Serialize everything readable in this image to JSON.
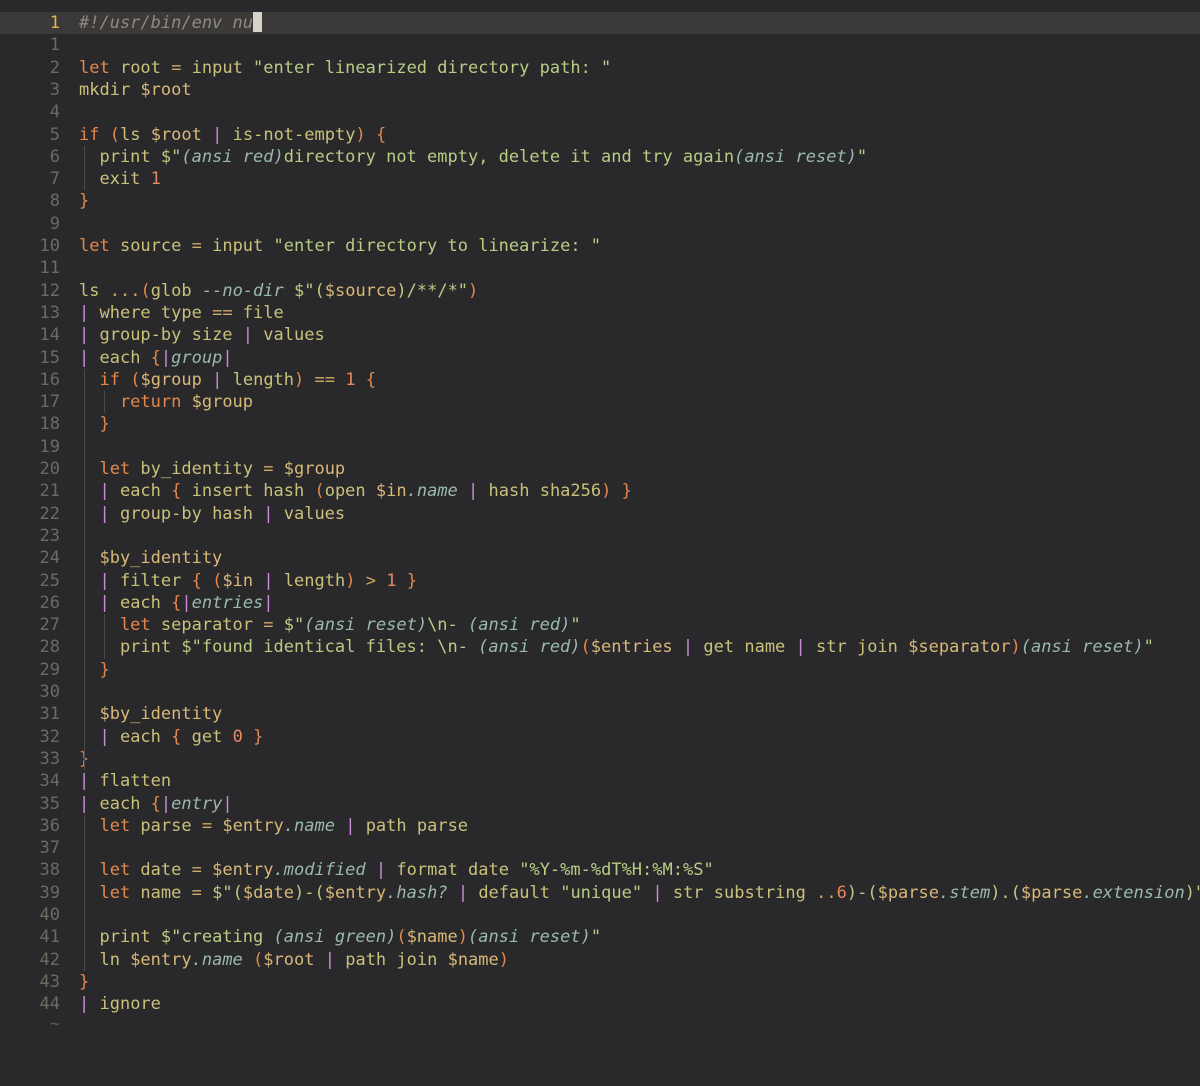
{
  "editor": {
    "tilde": "~",
    "lines": [
      {
        "num": "1",
        "tokens": [
          [
            "com",
            "#!/usr/bin/env nu"
          ]
        ],
        "cursor": true
      },
      {
        "num": "1",
        "tokens": []
      },
      {
        "num": "2",
        "tokens": [
          [
            "kw",
            "let"
          ],
          [
            "fn",
            " root "
          ],
          [
            "op",
            "="
          ],
          [
            "fn",
            " input "
          ],
          [
            "str",
            "\"enter linearized directory path: \""
          ]
        ]
      },
      {
        "num": "3",
        "tokens": [
          [
            "fn",
            "mkdir "
          ],
          [
            "var",
            "$root"
          ]
        ]
      },
      {
        "num": "4",
        "tokens": []
      },
      {
        "num": "5",
        "tokens": [
          [
            "kw",
            "if"
          ],
          [
            "fn",
            " "
          ],
          [
            "br",
            "("
          ],
          [
            "fn",
            "ls "
          ],
          [
            "var",
            "$root"
          ],
          [
            "fn",
            " "
          ],
          [
            "pipe",
            "|"
          ],
          [
            "fn",
            " is-not-empty"
          ],
          [
            "br",
            ")"
          ],
          [
            "fn",
            " "
          ],
          [
            "br",
            "{"
          ]
        ]
      },
      {
        "num": "6",
        "tokens": [
          [
            "fn",
            "  print "
          ],
          [
            "str",
            "$\""
          ],
          [
            "it",
            "(ansi red)"
          ],
          [
            "str",
            "directory not empty, delete it and try again"
          ],
          [
            "it",
            "(ansi reset)"
          ],
          [
            "str",
            "\""
          ]
        ]
      },
      {
        "num": "7",
        "tokens": [
          [
            "fn",
            "  exit "
          ],
          [
            "num",
            "1"
          ]
        ]
      },
      {
        "num": "8",
        "tokens": [
          [
            "br",
            "}"
          ]
        ]
      },
      {
        "num": "9",
        "tokens": []
      },
      {
        "num": "10",
        "tokens": [
          [
            "kw",
            "let"
          ],
          [
            "fn",
            " source "
          ],
          [
            "op",
            "="
          ],
          [
            "fn",
            " input "
          ],
          [
            "str",
            "\"enter directory to linearize: \""
          ]
        ]
      },
      {
        "num": "11",
        "tokens": []
      },
      {
        "num": "12",
        "tokens": [
          [
            "fn",
            "ls "
          ],
          [
            "op",
            "..."
          ],
          [
            "br",
            "("
          ],
          [
            "fn",
            "glob "
          ],
          [
            "it",
            "--no-dir"
          ],
          [
            "fn",
            " "
          ],
          [
            "str",
            "$\"("
          ],
          [
            "var",
            "$source"
          ],
          [
            "str",
            ")/**/*\""
          ],
          [
            "br",
            ")"
          ]
        ]
      },
      {
        "num": "13",
        "tokens": [
          [
            "pipe",
            "|"
          ],
          [
            "fn",
            " where type "
          ],
          [
            "op",
            "=="
          ],
          [
            "fn",
            " file"
          ]
        ]
      },
      {
        "num": "14",
        "tokens": [
          [
            "pipe",
            "|"
          ],
          [
            "fn",
            " group-by size "
          ],
          [
            "pipe",
            "|"
          ],
          [
            "fn",
            " values"
          ]
        ]
      },
      {
        "num": "15",
        "tokens": [
          [
            "pipe",
            "|"
          ],
          [
            "fn",
            " each "
          ],
          [
            "br",
            "{"
          ],
          [
            "pipe",
            "|"
          ],
          [
            "it",
            "group"
          ],
          [
            "pipe",
            "|"
          ]
        ]
      },
      {
        "num": "16",
        "tokens": [
          [
            "kw",
            "  if"
          ],
          [
            "fn",
            " "
          ],
          [
            "br",
            "("
          ],
          [
            "var",
            "$group"
          ],
          [
            "fn",
            " "
          ],
          [
            "pipe",
            "|"
          ],
          [
            "fn",
            " length"
          ],
          [
            "br",
            ")"
          ],
          [
            "fn",
            " "
          ],
          [
            "op",
            "=="
          ],
          [
            "fn",
            " "
          ],
          [
            "num",
            "1"
          ],
          [
            "fn",
            " "
          ],
          [
            "br",
            "{"
          ]
        ]
      },
      {
        "num": "17",
        "tokens": [
          [
            "kw",
            "    return"
          ],
          [
            "fn",
            " "
          ],
          [
            "var",
            "$group"
          ]
        ]
      },
      {
        "num": "18",
        "tokens": [
          [
            "br",
            "  }"
          ]
        ]
      },
      {
        "num": "19",
        "tokens": []
      },
      {
        "num": "20",
        "tokens": [
          [
            "kw",
            "  let"
          ],
          [
            "fn",
            " by_identity "
          ],
          [
            "op",
            "="
          ],
          [
            "fn",
            " "
          ],
          [
            "var",
            "$group"
          ]
        ]
      },
      {
        "num": "21",
        "tokens": [
          [
            "pipe",
            "  |"
          ],
          [
            "fn",
            " each "
          ],
          [
            "br",
            "{"
          ],
          [
            "fn",
            " insert hash "
          ],
          [
            "br",
            "("
          ],
          [
            "fn",
            "open "
          ],
          [
            "var",
            "$in"
          ],
          [
            "it",
            ".name"
          ],
          [
            "fn",
            " "
          ],
          [
            "pipe",
            "|"
          ],
          [
            "fn",
            " hash sha256"
          ],
          [
            "br",
            ")"
          ],
          [
            "fn",
            " "
          ],
          [
            "br",
            "}"
          ]
        ]
      },
      {
        "num": "22",
        "tokens": [
          [
            "pipe",
            "  |"
          ],
          [
            "fn",
            " group-by hash "
          ],
          [
            "pipe",
            "|"
          ],
          [
            "fn",
            " values"
          ]
        ]
      },
      {
        "num": "23",
        "tokens": []
      },
      {
        "num": "24",
        "tokens": [
          [
            "var",
            "  $by_identity"
          ]
        ]
      },
      {
        "num": "25",
        "tokens": [
          [
            "pipe",
            "  |"
          ],
          [
            "fn",
            " filter "
          ],
          [
            "br",
            "{"
          ],
          [
            "fn",
            " "
          ],
          [
            "br",
            "("
          ],
          [
            "var",
            "$in"
          ],
          [
            "fn",
            " "
          ],
          [
            "pipe",
            "|"
          ],
          [
            "fn",
            " length"
          ],
          [
            "br",
            ")"
          ],
          [
            "fn",
            " "
          ],
          [
            "op",
            ">"
          ],
          [
            "fn",
            " "
          ],
          [
            "num",
            "1"
          ],
          [
            "fn",
            " "
          ],
          [
            "br",
            "}"
          ]
        ]
      },
      {
        "num": "26",
        "tokens": [
          [
            "pipe",
            "  |"
          ],
          [
            "fn",
            " each "
          ],
          [
            "br",
            "{"
          ],
          [
            "pipe",
            "|"
          ],
          [
            "it",
            "entries"
          ],
          [
            "pipe",
            "|"
          ]
        ]
      },
      {
        "num": "27",
        "tokens": [
          [
            "kw",
            "    let"
          ],
          [
            "fn",
            " separator "
          ],
          [
            "op",
            "="
          ],
          [
            "fn",
            " "
          ],
          [
            "str",
            "$\""
          ],
          [
            "it",
            "(ansi reset)"
          ],
          [
            "str",
            "\\n- "
          ],
          [
            "it",
            "(ansi red)"
          ],
          [
            "str",
            "\""
          ]
        ]
      },
      {
        "num": "28",
        "tokens": [
          [
            "fn",
            "    print "
          ],
          [
            "str",
            "$\"found identical files: \\n- "
          ],
          [
            "it",
            "(ansi red)"
          ],
          [
            "br",
            "("
          ],
          [
            "var",
            "$entries"
          ],
          [
            "fn",
            " "
          ],
          [
            "pipe",
            "|"
          ],
          [
            "fn",
            " get name "
          ],
          [
            "pipe",
            "|"
          ],
          [
            "fn",
            " str join "
          ],
          [
            "var",
            "$separator"
          ],
          [
            "br",
            ")"
          ],
          [
            "it",
            "(ansi reset)"
          ],
          [
            "str",
            "\""
          ]
        ]
      },
      {
        "num": "29",
        "tokens": [
          [
            "br",
            "  }"
          ]
        ]
      },
      {
        "num": "30",
        "tokens": []
      },
      {
        "num": "31",
        "tokens": [
          [
            "var",
            "  $by_identity"
          ]
        ]
      },
      {
        "num": "32",
        "tokens": [
          [
            "pipe",
            "  |"
          ],
          [
            "fn",
            " each "
          ],
          [
            "br",
            "{"
          ],
          [
            "fn",
            " get "
          ],
          [
            "num",
            "0"
          ],
          [
            "fn",
            " "
          ],
          [
            "br",
            "}"
          ]
        ]
      },
      {
        "num": "33",
        "tokens": [
          [
            "br",
            "}"
          ]
        ]
      },
      {
        "num": "34",
        "tokens": [
          [
            "pipe",
            "|"
          ],
          [
            "fn",
            " flatten"
          ]
        ]
      },
      {
        "num": "35",
        "tokens": [
          [
            "pipe",
            "|"
          ],
          [
            "fn",
            " each "
          ],
          [
            "br",
            "{"
          ],
          [
            "pipe",
            "|"
          ],
          [
            "it",
            "entry"
          ],
          [
            "pipe",
            "|"
          ]
        ]
      },
      {
        "num": "36",
        "tokens": [
          [
            "kw",
            "  let"
          ],
          [
            "fn",
            " parse "
          ],
          [
            "op",
            "="
          ],
          [
            "fn",
            " "
          ],
          [
            "var",
            "$entry"
          ],
          [
            "it",
            ".name"
          ],
          [
            "fn",
            " "
          ],
          [
            "pipe",
            "|"
          ],
          [
            "fn",
            " path parse"
          ]
        ]
      },
      {
        "num": "37",
        "tokens": []
      },
      {
        "num": "38",
        "tokens": [
          [
            "kw",
            "  let"
          ],
          [
            "fn",
            " date "
          ],
          [
            "op",
            "="
          ],
          [
            "fn",
            " "
          ],
          [
            "var",
            "$entry"
          ],
          [
            "it",
            ".modified"
          ],
          [
            "fn",
            " "
          ],
          [
            "pipe",
            "|"
          ],
          [
            "fn",
            " format date "
          ],
          [
            "str",
            "\"%Y-%m-%dT%H:%M:%S\""
          ]
        ]
      },
      {
        "num": "39",
        "tokens": [
          [
            "kw",
            "  let"
          ],
          [
            "fn",
            " name "
          ],
          [
            "op",
            "="
          ],
          [
            "fn",
            " "
          ],
          [
            "str",
            "$\"("
          ],
          [
            "var",
            "$date"
          ],
          [
            "str",
            ")-("
          ],
          [
            "var",
            "$entry"
          ],
          [
            "it",
            ".hash?"
          ],
          [
            "fn",
            " "
          ],
          [
            "pipe",
            "|"
          ],
          [
            "fn",
            " default "
          ],
          [
            "str",
            "\"unique\""
          ],
          [
            "fn",
            " "
          ],
          [
            "pipe",
            "|"
          ],
          [
            "fn",
            " str substring "
          ],
          [
            "op",
            ".."
          ],
          [
            "num",
            "6"
          ],
          [
            "str",
            ")-("
          ],
          [
            "var",
            "$parse"
          ],
          [
            "it",
            ".stem"
          ],
          [
            "str",
            ").("
          ],
          [
            "var",
            "$parse"
          ],
          [
            "it",
            ".extension"
          ],
          [
            "str",
            ")\""
          ]
        ]
      },
      {
        "num": "40",
        "tokens": []
      },
      {
        "num": "41",
        "tokens": [
          [
            "fn",
            "  print "
          ],
          [
            "str",
            "$\"creating "
          ],
          [
            "it",
            "(ansi green)"
          ],
          [
            "br",
            "("
          ],
          [
            "var",
            "$name"
          ],
          [
            "br",
            ")"
          ],
          [
            "it",
            "(ansi reset)"
          ],
          [
            "str",
            "\""
          ]
        ]
      },
      {
        "num": "42",
        "tokens": [
          [
            "fn",
            "  ln "
          ],
          [
            "var",
            "$entry"
          ],
          [
            "it",
            ".name"
          ],
          [
            "fn",
            " "
          ],
          [
            "br",
            "("
          ],
          [
            "var",
            "$root"
          ],
          [
            "fn",
            " "
          ],
          [
            "pipe",
            "|"
          ],
          [
            "fn",
            " path join "
          ],
          [
            "var",
            "$name"
          ],
          [
            "br",
            ")"
          ]
        ]
      },
      {
        "num": "43",
        "tokens": [
          [
            "br",
            "}"
          ]
        ]
      },
      {
        "num": "44",
        "tokens": [
          [
            "pipe",
            "|"
          ],
          [
            "fn",
            " ignore"
          ]
        ]
      }
    ]
  }
}
